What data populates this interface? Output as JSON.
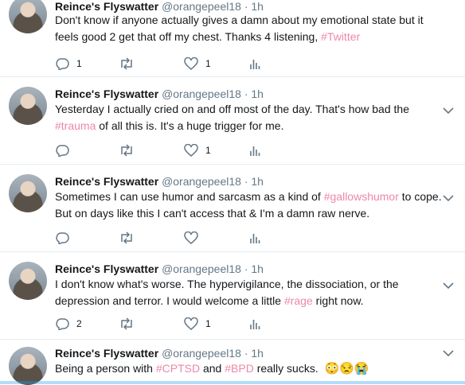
{
  "tweets": [
    {
      "name": "Reince's Flyswatter",
      "handle": "@orangepeel18",
      "dot": "·",
      "time": "1h",
      "line1": "Don't know if anyone actually gives a damn about my emotional state but it",
      "line2_before": "feels good 2 get that off my chest.  Thanks 4 listening, ",
      "line2_hashtag": "#Twitter",
      "line2_after": "",
      "reply_count": "1",
      "retweet_count": "",
      "like_count": "1"
    },
    {
      "name": "Reince's Flyswatter",
      "handle": "@orangepeel18",
      "dot": "·",
      "time": "1h",
      "line1": "Yesterday I actually cried on and off most of the day.  That's how bad the",
      "line2_before": "",
      "line2_hashtag": "#trauma",
      "line2_after": " of all this is.  It's a huge trigger for me.",
      "reply_count": "",
      "retweet_count": "",
      "like_count": "1"
    },
    {
      "name": "Reince's Flyswatter",
      "handle": "@orangepeel18",
      "dot": "·",
      "time": "1h",
      "line1_before": "Sometimes I can use humor and sarcasm as a kind of ",
      "line1_hashtag": "#gallowshumor",
      "line1_after": " to cope.",
      "line2": "But on days like this I can't access that & I'm a damn raw nerve.",
      "reply_count": "",
      "retweet_count": "",
      "like_count": ""
    },
    {
      "name": "Reince's Flyswatter",
      "handle": "@orangepeel18",
      "dot": "·",
      "time": "1h",
      "line1": "I don't know what's worse.  The hypervigilance, the dissociation, or the",
      "line2_before": "depression and terror.  I would welcome a little ",
      "line2_hashtag": "#rage",
      "line2_after": " right now.",
      "reply_count": "2",
      "retweet_count": "",
      "like_count": "1"
    },
    {
      "name": "Reince's Flyswatter",
      "handle": "@orangepeel18",
      "dot": "·",
      "time": "1h",
      "text_a": "Being a person with ",
      "hashtag_a": "#CPTSD",
      "text_b": " and ",
      "hashtag_b": "#BPD",
      "text_c": " really sucks.",
      "emojis": "😳😒😭"
    }
  ],
  "colors": {
    "hashtag": "#e0245e",
    "muted": "#657786",
    "divider": "#e6ecf0"
  }
}
